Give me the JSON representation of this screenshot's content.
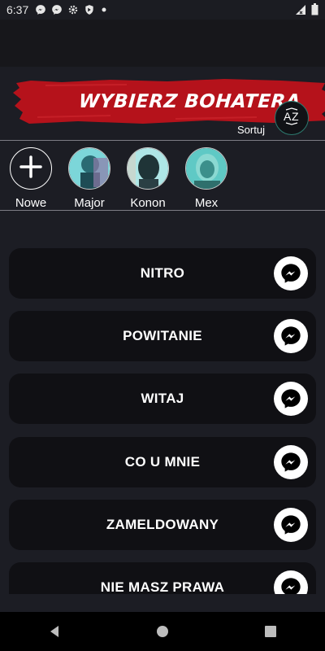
{
  "status": {
    "time": "6:37"
  },
  "header": {
    "title": "WYBIERZ BOHATERA",
    "sort_label": "Sortuj",
    "sort_icon_text": "AZ",
    "brush_color": "#b5121b"
  },
  "heroes": [
    {
      "name": "Nowe"
    },
    {
      "name": "Major"
    },
    {
      "name": "Konon"
    },
    {
      "name": "Mex"
    }
  ],
  "items": [
    {
      "label": "NITRO"
    },
    {
      "label": "POWITANIE"
    },
    {
      "label": "WITAJ"
    },
    {
      "label": "CO U MNIE"
    },
    {
      "label": "ZAMELDOWANY"
    },
    {
      "label": "NIE MASZ PRAWA"
    }
  ],
  "icons": {
    "status": [
      "messenger-icon",
      "messenger-icon",
      "settings-icon",
      "shield-icon",
      "dot-icon",
      "wifi-icon",
      "signal-icon",
      "battery-icon"
    ],
    "list": "messenger-icon",
    "nav": [
      "back-icon",
      "home-icon",
      "recents-icon"
    ]
  }
}
